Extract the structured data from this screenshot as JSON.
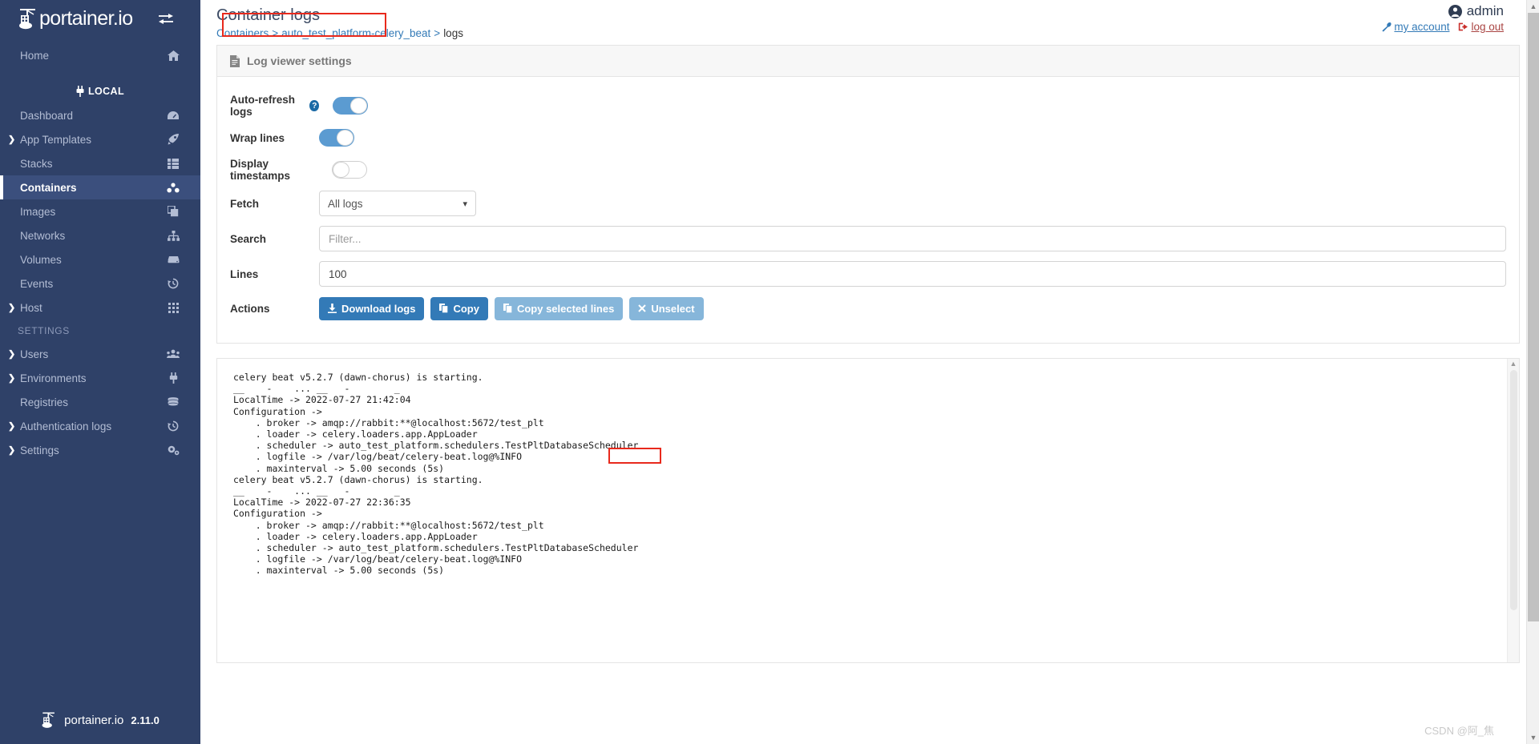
{
  "sidebar": {
    "brand": {
      "name": "portainer.io",
      "toggle_icon": "collapse-arrows-icon"
    },
    "items": [
      {
        "label": "Home",
        "icon": "home-icon",
        "type": "link",
        "expandable": false
      },
      {
        "label": "LOCAL",
        "icon": "plug-icon",
        "type": "environment-header"
      },
      {
        "label": "Dashboard",
        "icon": "dashboard-icon",
        "type": "link",
        "expandable": false
      },
      {
        "label": "App Templates",
        "icon": "rocket-icon",
        "type": "link",
        "expandable": true
      },
      {
        "label": "Stacks",
        "icon": "stacks-icon",
        "type": "link",
        "expandable": false
      },
      {
        "label": "Containers",
        "icon": "containers-icon",
        "type": "link",
        "expandable": false,
        "active": true
      },
      {
        "label": "Images",
        "icon": "images-icon",
        "type": "link",
        "expandable": false
      },
      {
        "label": "Networks",
        "icon": "networks-icon",
        "type": "link",
        "expandable": false
      },
      {
        "label": "Volumes",
        "icon": "volumes-icon",
        "type": "link",
        "expandable": false
      },
      {
        "label": "Events",
        "icon": "history-icon",
        "type": "link",
        "expandable": false
      },
      {
        "label": "Host",
        "icon": "grid-icon",
        "type": "link",
        "expandable": true
      },
      {
        "label": "SETTINGS",
        "type": "section"
      },
      {
        "label": "Users",
        "icon": "users-icon",
        "type": "link",
        "expandable": true
      },
      {
        "label": "Environments",
        "icon": "plug-icon",
        "type": "link",
        "expandable": true
      },
      {
        "label": "Registries",
        "icon": "database-icon",
        "type": "link",
        "expandable": false
      },
      {
        "label": "Authentication logs",
        "icon": "history-icon",
        "type": "link",
        "expandable": true
      },
      {
        "label": "Settings",
        "icon": "gears-icon",
        "type": "link",
        "expandable": true
      }
    ],
    "footer": {
      "name": "portainer.io",
      "version": "2.11.0"
    }
  },
  "header": {
    "title": "Container logs",
    "breadcrumb": {
      "root": "Containers",
      "separator": ">",
      "container": "auto_test_platform-celery_beat",
      "current": "logs"
    },
    "user": {
      "name": "admin",
      "my_account": "my account",
      "log_out": "log out"
    }
  },
  "settings_panel": {
    "title": "Log viewer settings",
    "icon": "file-text-icon",
    "rows": {
      "auto_refresh": {
        "label": "Auto-refresh logs",
        "help": "?",
        "state": "on"
      },
      "wrap_lines": {
        "label": "Wrap lines",
        "state": "on"
      },
      "display_timestamps": {
        "label": "Display timestamps",
        "state": "off"
      },
      "fetch": {
        "label": "Fetch",
        "value": "All logs",
        "options": [
          "All logs"
        ]
      },
      "search": {
        "label": "Search",
        "value": "",
        "placeholder": "Filter..."
      },
      "lines": {
        "label": "Lines",
        "value": "100"
      },
      "actions": {
        "label": "Actions",
        "buttons": [
          {
            "label": "Download logs",
            "icon": "download-icon",
            "style": "primary"
          },
          {
            "label": "Copy",
            "icon": "copy-icon",
            "style": "primary"
          },
          {
            "label": "Copy selected lines",
            "icon": "copy-icon",
            "style": "light"
          },
          {
            "label": "Unselect",
            "icon": "times-icon",
            "style": "light"
          }
        ]
      }
    }
  },
  "log_viewer": {
    "text": "celery beat v5.2.7 (dawn-chorus) is starting.\n__    -    ... __   -        _\nLocalTime -> 2022-07-27 21:42:04\nConfiguration ->\n    . broker -> amqp://rabbit:**@localhost:5672/test_plt\n    . loader -> celery.loaders.app.AppLoader\n    . scheduler -> auto_test_platform.schedulers.TestPltDatabaseScheduler\n    . logfile -> /var/log/beat/celery-beat.log@%INFO\n    . maxinterval -> 5.00 seconds (5s)\ncelery beat v5.2.7 (dawn-chorus) is starting.\n__    -    ... __   -        _\nLocalTime -> 2022-07-27 22:36:35\nConfiguration ->\n    . broker -> amqp://rabbit:**@localhost:5672/test_plt\n    . loader -> celery.loaders.app.AppLoader\n    . scheduler -> auto_test_platform.schedulers.TestPltDatabaseScheduler\n    . logfile -> /var/log/beat/celery-beat.log@%INFO\n    . maxinterval -> 5.00 seconds (5s)"
  },
  "annotations": {
    "breadcrumb_highlight": "auto_test_platform-celery_beat >",
    "broker_highlight": "/test_plt",
    "color": "#e8291c"
  },
  "watermark": {
    "text": "CSDN @阿_焦"
  },
  "colors": {
    "sidebar_bg": "#2f4168",
    "sidebar_active": "#3b4f7d",
    "primary": "#337ab7",
    "light_blue": "#86b6da",
    "toggle_on": "#5b9bd1",
    "annotation": "#e8291c"
  }
}
